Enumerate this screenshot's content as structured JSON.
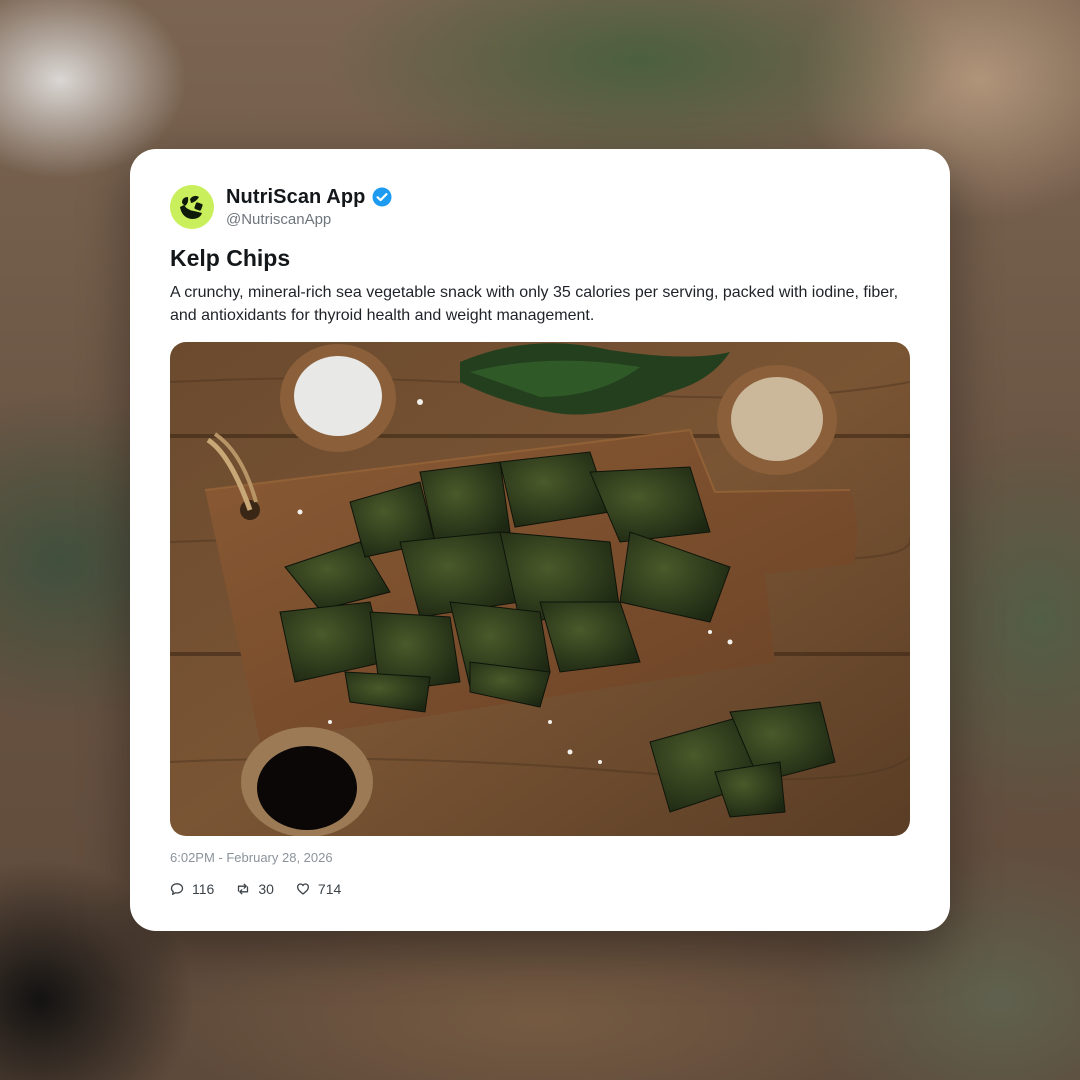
{
  "post": {
    "author": {
      "name": "NutriScan App",
      "handle": "@NutriscanApp",
      "verified": true,
      "avatar_icon": "leaf-logo-icon",
      "avatar_color": "#c9ef5c"
    },
    "title": "Kelp Chips",
    "body": "A crunchy, mineral-rich sea vegetable snack with only 35 calories per serving, packed with iodine, fiber, and antioxidants for thyroid health and weight management.",
    "image_icon": "kelp-chips-photo",
    "timestamp": "6:02PM - February 28, 2026",
    "stats": {
      "replies": "116",
      "reposts": "30",
      "likes": "714"
    }
  },
  "colors": {
    "verified_badge": "#1d9bf0",
    "card_background": "#ffffff",
    "text_primary": "#14171a",
    "text_secondary": "#6e767d"
  }
}
